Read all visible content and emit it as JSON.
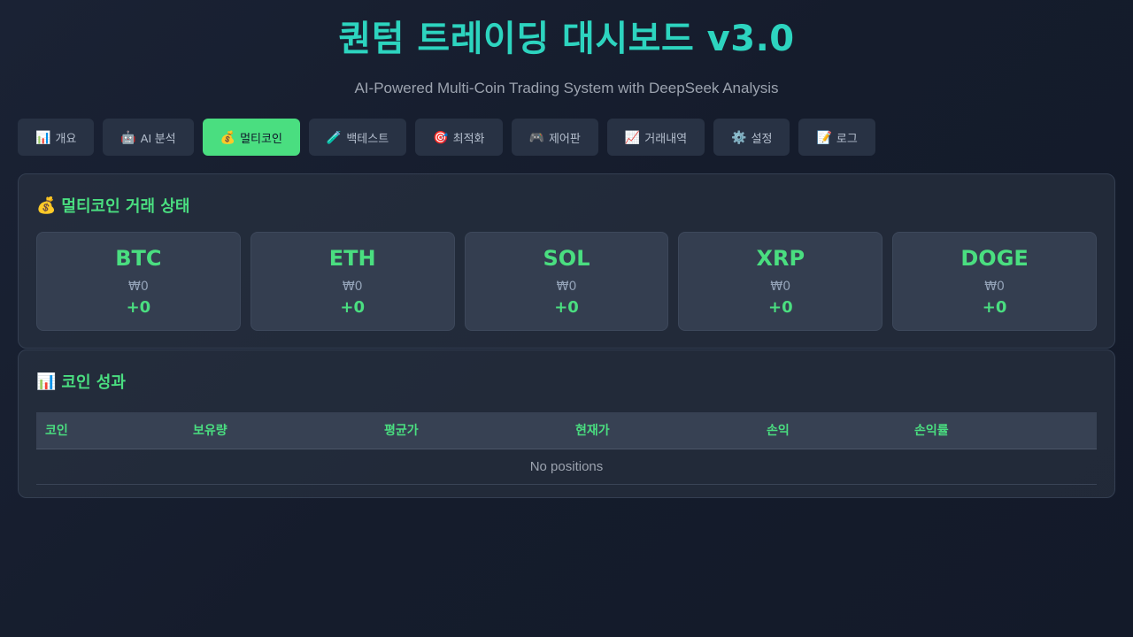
{
  "header": {
    "title": "퀀텀 트레이딩 대시보드 v3.0",
    "subtitle": "AI-Powered Multi-Coin Trading System with DeepSeek Analysis"
  },
  "tabs": [
    {
      "icon": "📊",
      "label": "개요",
      "icon_name": "bar-chart-icon"
    },
    {
      "icon": "🤖",
      "label": "AI 분석",
      "icon_name": "robot-icon"
    },
    {
      "icon": "💰",
      "label": "멀티코인",
      "icon_name": "money-bag-icon",
      "active": true
    },
    {
      "icon": "🧪",
      "label": "백테스트",
      "icon_name": "test-tube-icon"
    },
    {
      "icon": "🎯",
      "label": "최적화",
      "icon_name": "target-icon"
    },
    {
      "icon": "🎮",
      "label": "제어판",
      "icon_name": "gamepad-icon"
    },
    {
      "icon": "📈",
      "label": "거래내역",
      "icon_name": "chart-up-icon"
    },
    {
      "icon": "⚙️",
      "label": "설정",
      "icon_name": "gear-icon"
    },
    {
      "icon": "📝",
      "label": "로그",
      "icon_name": "memo-icon"
    }
  ],
  "status_section": {
    "icon": "💰",
    "title": "멀티코인 거래 상태",
    "coins": [
      {
        "symbol": "BTC",
        "price": "₩0",
        "change": "+0"
      },
      {
        "symbol": "ETH",
        "price": "₩0",
        "change": "+0"
      },
      {
        "symbol": "SOL",
        "price": "₩0",
        "change": "+0"
      },
      {
        "symbol": "XRP",
        "price": "₩0",
        "change": "+0"
      },
      {
        "symbol": "DOGE",
        "price": "₩0",
        "change": "+0"
      }
    ]
  },
  "performance_section": {
    "icon": "📊",
    "title": "코인 성과",
    "columns": [
      "코인",
      "보유량",
      "평균가",
      "현재가",
      "손익",
      "손익률"
    ],
    "empty_text": "No positions"
  },
  "colors": {
    "accent_green": "#4ade80",
    "title_teal": "#2dd4bf",
    "background": "#151c2c"
  }
}
